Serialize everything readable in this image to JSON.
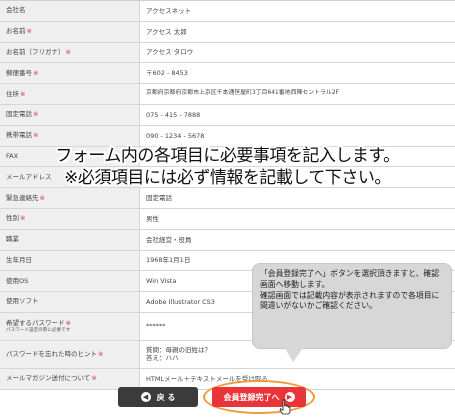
{
  "form": {
    "rows": [
      {
        "label": "会社名",
        "required": "",
        "value": "アクセスネット"
      },
      {
        "label": "お名前",
        "required": "※",
        "value": "アクセス 太郎"
      },
      {
        "label": "お名前（フリガナ）",
        "required": "※",
        "value": "アクセス タロウ"
      },
      {
        "label": "郵便番号",
        "required": "※",
        "value": "〒602 - 8453"
      },
      {
        "label": "住所",
        "required": "※",
        "value": "京都府京都府京都市上京区千本通笹屋町3丁目641番地西陣セントラル2F"
      },
      {
        "label": "固定電話",
        "required": "※",
        "value": "075 - 415 - 7888"
      },
      {
        "label": "携帯電話",
        "required": "※",
        "value": "090 - 1234 - 5678"
      },
      {
        "label": "FAX",
        "required": "",
        "value": ""
      },
      {
        "label": "メールアドレス",
        "required": "",
        "value": ""
      },
      {
        "label": "緊急連絡先",
        "required": "※",
        "value": "固定電話"
      },
      {
        "label": "性別",
        "required": "※",
        "value": "男性"
      },
      {
        "label": "職業",
        "required": "",
        "value": "会社経営・役員"
      },
      {
        "label": "生年月日",
        "required": "",
        "value": "1968年1月1日"
      },
      {
        "label": "使用OS",
        "required": "",
        "value": "Win Vista"
      },
      {
        "label": "使用ソフト",
        "required": "",
        "value": "Adobe Illustrator CS3"
      },
      {
        "label": "希望するパスワード",
        "required": "※",
        "sublabel": "パスワード設定の際に必要です",
        "value": "******"
      },
      {
        "label": "パスワードを忘れた時のヒント",
        "required": "※",
        "value": "質問：母親の旧姓は？",
        "value2": "答え：ハハ"
      },
      {
        "label": "メールマガジン送付について",
        "required": "※",
        "value": "HTMLメール＋テキストメールを受け取る"
      }
    ]
  },
  "overlay": {
    "line1": "フォーム内の各項目に必要事項を記入します。",
    "line2": "※必須項目には必ず情報を記載して下さい。"
  },
  "callout": {
    "text1": "「会員登録完了へ」ボタンを選択頂きますと、確認画面へ移動します。",
    "text2": "確認画面では記載内容が表示されますので各項目に間違いがないかご確認ください。"
  },
  "buttons": {
    "back_label": "戻 る",
    "next_label": "会員登録完了へ"
  },
  "colors": {
    "required": "#e0343a",
    "next_button": "#e9343a",
    "back_button": "#3b3b3b",
    "highlight": "#f29a38"
  },
  "icons": {
    "back": "chevron-left-circle-icon",
    "next": "chevron-right-circle-icon",
    "cursor": "hand-pointer-icon"
  }
}
